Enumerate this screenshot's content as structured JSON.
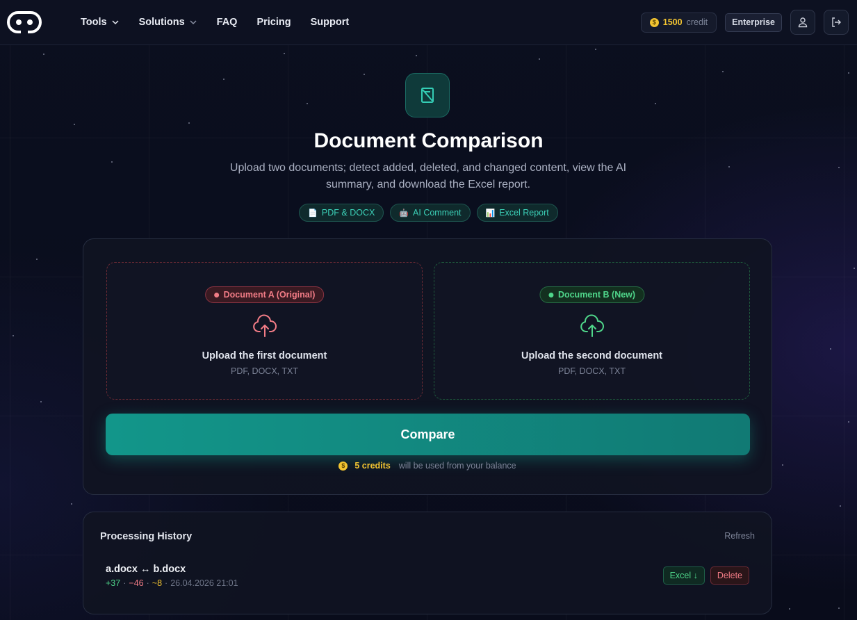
{
  "header": {
    "nav": [
      {
        "label": "Tools",
        "dropdown": true
      },
      {
        "label": "Solutions",
        "dropdown": true
      },
      {
        "label": "FAQ",
        "dropdown": false
      },
      {
        "label": "Pricing",
        "dropdown": false
      },
      {
        "label": "Support",
        "dropdown": false
      }
    ],
    "credit_amount": "1500",
    "credit_label": "credit",
    "enterprise_label": "Enterprise"
  },
  "hero": {
    "icon": "document-compare-icon",
    "title": "Document Comparison",
    "subtitle": "Upload two documents; detect added, deleted, and changed content, view the AI summary, and download the Excel report.",
    "chips": [
      {
        "icon": "📄",
        "label": "PDF & DOCX"
      },
      {
        "icon": "🤖",
        "label": "AI Comment"
      },
      {
        "icon": "📊",
        "label": "Excel Report"
      }
    ]
  },
  "upload": {
    "doc_a": {
      "tag": "Document A (Original)",
      "title": "Upload the first document",
      "formats": "PDF, DOCX, TXT"
    },
    "doc_b": {
      "tag": "Document B (New)",
      "title": "Upload the second document",
      "formats": "PDF, DOCX, TXT"
    },
    "compare_label": "Compare",
    "cost_amount": "5 credits",
    "cost_text": "will be used from your balance"
  },
  "history": {
    "title": "Processing History",
    "refresh_label": "Refresh",
    "rows": [
      {
        "name": "a.docx ↔ b.docx",
        "added": "+37",
        "deleted": "−46",
        "changed": "~8",
        "separator": "·",
        "timestamp": "26.04.2026 21:01",
        "excel_label": "Excel ↓",
        "delete_label": "Delete"
      }
    ]
  },
  "colors": {
    "accent_teal": "#12968a",
    "credit_gold": "#f2c431",
    "doc_a_red": "#f27c86",
    "doc_b_green": "#4fd68a",
    "background": "#0a0d1c"
  }
}
